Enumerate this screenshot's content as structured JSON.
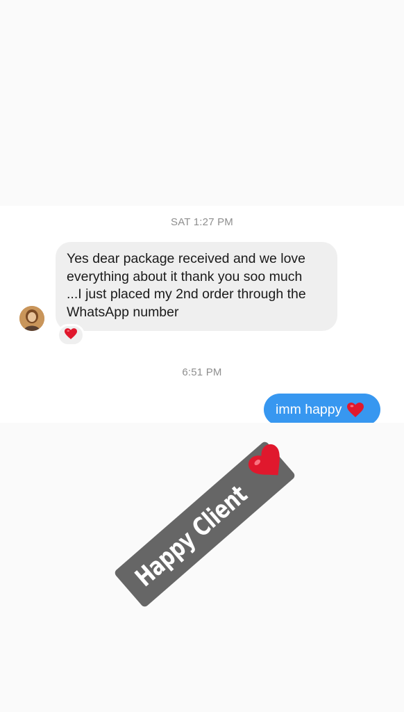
{
  "conversation": {
    "timestamp_1": "SAT 1:27 PM",
    "incoming_message": {
      "lines": [
        "Yes dear package received and we love",
        "everything about it thank you soo much",
        "...I just placed my 2nd order through the",
        "WhatsApp number"
      ],
      "reaction_icon": "red-heart-emoji"
    },
    "timestamp_2": "6:51 PM",
    "outgoing_message": {
      "text": "imm happy",
      "emoji": "red-heart-emoji"
    }
  },
  "sticker": {
    "text": "Happy Client",
    "emoji": "red-heart-emoji",
    "background_color": "#666666"
  },
  "colors": {
    "outgoing_bubble": "#3797f0",
    "incoming_bubble": "#efefef",
    "heart": "#e0182d",
    "timestamp_text": "#8e8e8e"
  }
}
